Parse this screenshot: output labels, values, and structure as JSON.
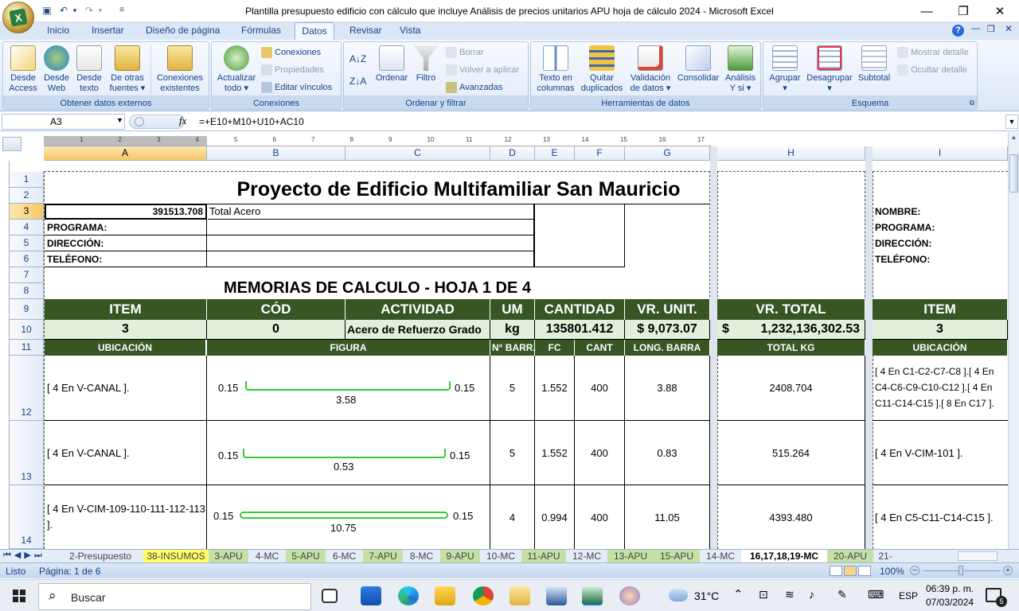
{
  "window": {
    "title": "Plantilla presupuesto edificio con cálculo que incluye Análisis de precios unitarios APU  hoja de cálculo 2024 - Microsoft Excel",
    "minimize": "—",
    "restore": "❐",
    "close": "✕"
  },
  "ribbon_tabs": [
    "Inicio",
    "Insertar",
    "Diseño de página",
    "Fórmulas",
    "Datos",
    "Revisar",
    "Vista"
  ],
  "ribbon": {
    "groups": {
      "obtener": "Obtener datos externos",
      "conexiones": "Conexiones",
      "ordenar": "Ordenar y filtrar",
      "herramientas": "Herramientas de datos",
      "esquema": "Esquema"
    },
    "buttons": {
      "desde_access": "Desde\nAccess",
      "desde_web": "Desde\nWeb",
      "desde_texto": "Desde\ntexto",
      "otras_fuentes": "De otras\nfuentes ▾",
      "conexiones_existentes": "Conexiones\nexistentes",
      "actualizar_todo": "Actualizar\ntodo ▾",
      "conexiones": "Conexiones",
      "propiedades": "Propiedades",
      "editar_vinculos": "Editar vínculos",
      "ordenar": "Ordenar",
      "filtro": "Filtro",
      "borrar": "Borrar",
      "volver_aplicar": "Volver a aplicar",
      "avanzadas": "Avanzadas",
      "texto_columnas": "Texto en\ncolumnas",
      "quitar_duplicados": "Quitar\nduplicados",
      "validacion": "Validación\nde datos ▾",
      "consolidar": "Consolidar",
      "analisis": "Análisis\nY si ▾",
      "agrupar": "Agrupar\n▾",
      "desagrupar": "Desagrupar\n▾",
      "subtotal": "Subtotal",
      "mostrar_detalle": "Mostrar detalle",
      "ocultar_detalle": "Ocultar detalle"
    }
  },
  "formula_bar": {
    "name_box": "A3",
    "fx": "fx",
    "formula": "=+E10+M10+U10+AC10"
  },
  "columns": [
    {
      "id": "A",
      "label": "A"
    },
    {
      "id": "B",
      "label": "B"
    },
    {
      "id": "C",
      "label": "C"
    },
    {
      "id": "D",
      "label": "D"
    },
    {
      "id": "E",
      "label": "E"
    },
    {
      "id": "F",
      "label": "F"
    },
    {
      "id": "G",
      "label": "G"
    },
    {
      "id": "H",
      "label": "H"
    },
    {
      "id": "I",
      "label": "I"
    }
  ],
  "ruler_marks": [
    "1",
    "2",
    "3",
    "4",
    "5",
    "6",
    "7",
    "8",
    "9",
    "10",
    "11",
    "12",
    "13",
    "14",
    "15",
    "16",
    "17"
  ],
  "rows": [
    "1",
    "2",
    "3",
    "4",
    "5",
    "6",
    "7",
    "8",
    "9",
    "10",
    "11",
    "12",
    "13",
    "14"
  ],
  "sheet": {
    "title": "Proyecto de Edificio Multifamiliar San Mauricio",
    "a3_value": "391513.708",
    "b3_value": "Total Acero",
    "labels": {
      "nombre": "NOMBRE:",
      "programa": "PROGRAMA:",
      "direccion": "DIRECCIÓN:",
      "telefono": "TELÉFONO:"
    },
    "memorias": "MEMORIAS DE CALCULO - HOJA 1 DE 4",
    "headers": {
      "item": "ITEM",
      "cod": "CÓD",
      "actividad": "ACTIVIDAD",
      "um": "UM",
      "cantidad": "CANTIDAD",
      "vr_unit": "VR. UNIT.",
      "vr_total": "VR. TOTAL",
      "item2": "ITEM"
    },
    "row10": {
      "item": "3",
      "cod": "0",
      "actividad": "Acero de Refuerzo Grado",
      "um": "kg",
      "cantidad": "135801.412",
      "vr_unit": "$ 9,073.07",
      "vr_total_sym": "$",
      "vr_total": "1,232,136,302.53",
      "item2": "3"
    },
    "subheaders": {
      "ubicacion": "UBICACIÓN",
      "figura": "FIGURA",
      "n_barra": "N° BARRA",
      "fc": "FC",
      "cant": "CANT",
      "long_barra": "LONG. BARRA",
      "total_kg": "TOTAL KG",
      "ubicacion2": "UBICACIÓN"
    },
    "data_rows": [
      {
        "ubicacion": "[ 4 En V-CANAL ].",
        "hook_left": "0.15",
        "hook_right": "0.15",
        "length": "3.58",
        "n_barra": "5",
        "fc": "1.552",
        "cant": "400",
        "long": "3.88",
        "total": "2408.704",
        "ubicacion2": "[ 4 En C1-C2-C7-C8 ].[ 4 En C4-C6-C9-C10-C12 ].[ 4 En C11-C14-C15 ].[ 8 En C17 ]."
      },
      {
        "ubicacion": "[ 4 En V-CANAL ].",
        "hook_left": "0.15",
        "hook_right": "0.15",
        "length": "0.53",
        "n_barra": "5",
        "fc": "1.552",
        "cant": "400",
        "long": "0.83",
        "total": "515.264",
        "ubicacion2": "[ 4 En V-CIM-101 ]."
      },
      {
        "ubicacion": "[ 4 En V-CIM-109-110-111-112-113 ].",
        "hook_left": "0.15",
        "hook_right": "0.15",
        "length": "10.75",
        "n_barra": "4",
        "fc": "0.994",
        "cant": "400",
        "long": "11.05",
        "total": "4393.480",
        "ubicacion2": "[ 4 En C5-C11-C14-C15 ]."
      }
    ]
  },
  "sheet_tabs": [
    {
      "label": "2-Presupuesto",
      "style": "plain"
    },
    {
      "label": "38-INSUMOS",
      "style": "yellow"
    },
    {
      "label": "3-APU",
      "style": "green"
    },
    {
      "label": "4-MC",
      "style": "plain"
    },
    {
      "label": "5-APU",
      "style": "green"
    },
    {
      "label": "6-MC",
      "style": "plain"
    },
    {
      "label": "7-APU",
      "style": "green"
    },
    {
      "label": "8-MC",
      "style": "plain"
    },
    {
      "label": "9-APU",
      "style": "green"
    },
    {
      "label": "10-MC",
      "style": "plain"
    },
    {
      "label": "11-APU",
      "style": "green"
    },
    {
      "label": "12-MC",
      "style": "plain"
    },
    {
      "label": "13-APU",
      "style": "green"
    },
    {
      "label": "15-APU",
      "style": "green"
    },
    {
      "label": "14-MC",
      "style": "plain"
    },
    {
      "label": "16,17,18,19-MC",
      "style": "active"
    },
    {
      "label": "20-APU",
      "style": "green"
    },
    {
      "label": "21-",
      "style": "plain"
    }
  ],
  "status": {
    "ready": "Listo",
    "page": "Página: 1 de 6",
    "zoom": "100%"
  },
  "taskbar": {
    "search": "Buscar",
    "weather": "31°C",
    "lang": "ESP",
    "time": "06:39 p. m.",
    "date": "07/03/2024",
    "notif": "5"
  },
  "colors": {
    "dark_green": "#375623",
    "light_green": "#e2efda",
    "ribbon_blue": "#15428b",
    "hook_green": "#33cc33"
  }
}
